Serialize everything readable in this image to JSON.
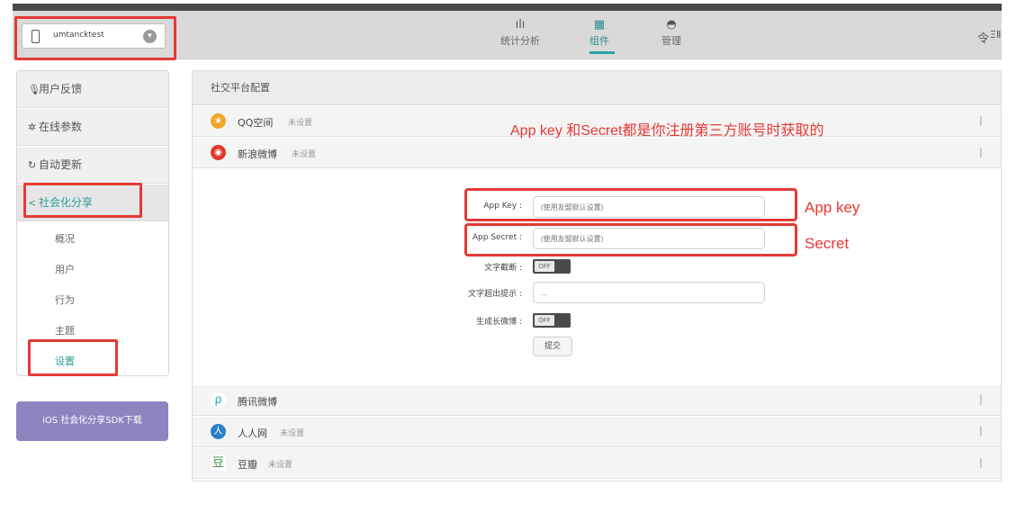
{
  "header": {
    "app_name": "umtancktest",
    "nav": [
      {
        "icon": "bar-chart-icon",
        "label": "统计分析"
      },
      {
        "icon": "grid-icon",
        "label": "组件"
      },
      {
        "icon": "gauge-icon",
        "label": "管理"
      }
    ],
    "user_icon_glyph": "令",
    "user_text": "ΞⅡ"
  },
  "sidebar": {
    "items": [
      {
        "icon": "mic-icon",
        "label": "用户反馈"
      },
      {
        "icon": "gear-icon",
        "label": "在线参数"
      },
      {
        "icon": "refresh-icon",
        "label": "自动更新"
      },
      {
        "icon": "share-icon",
        "label": "社会化分享"
      }
    ],
    "subitems": [
      "概况",
      "用户",
      "行为",
      "主题",
      "设置"
    ],
    "sdk_button": "iOS 社会化分享SDK下载"
  },
  "panel": {
    "title": "社交平台配置",
    "platforms_top": [
      {
        "icon": "qzone-icon",
        "name": "QQ空间",
        "status": "未设置"
      },
      {
        "icon": "weibo-icon",
        "name": "新浪微博",
        "status": "未设置"
      }
    ],
    "form": {
      "app_key_label": "App Key :",
      "app_key_placeholder": "(使用友盟默认设置)",
      "app_secret_label": "App Secret :",
      "app_secret_placeholder": "(使用友盟默认设置)",
      "text_cut_label": "文字截断 :",
      "text_cut_toggle": "OFF",
      "overflow_hint_label": "文字超出提示 :",
      "overflow_hint_value": "...",
      "long_weibo_label": "生成长微博 :",
      "long_weibo_toggle": "OFF",
      "submit": "提交"
    },
    "platforms_bottom": [
      {
        "icon": "tencent-weibo-icon",
        "name": "腾讯微博",
        "status": ""
      },
      {
        "icon": "renren-icon",
        "name": "人人网",
        "status": "未设置"
      },
      {
        "icon": "douban-icon",
        "name": "豆瓣",
        "status": "未设置"
      }
    ]
  },
  "annotations": {
    "top_note": "App key 和Secret都是你注册第三方账号时获取的",
    "app_key_note": "App key",
    "secret_note": "Secret"
  },
  "colors": {
    "annotation_red": "#e53935",
    "teal_accent": "#2aa3a3",
    "sdk_button": "#8c85c0"
  }
}
